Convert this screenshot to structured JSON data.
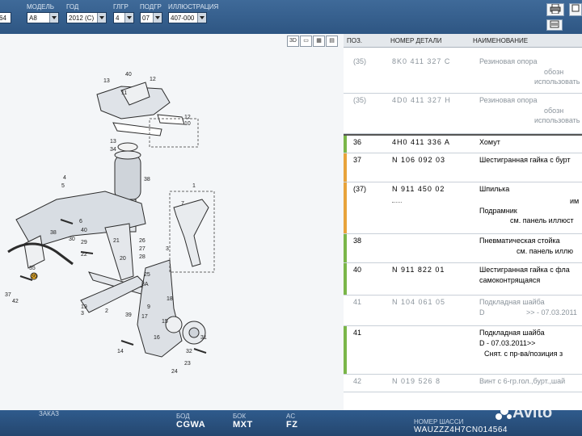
{
  "toolbar": {
    "fields": [
      {
        "label": "",
        "value": "64"
      },
      {
        "label": "МОДЕЛЬ",
        "value": "A8"
      },
      {
        "label": "ГОД",
        "value": "2012 (C)"
      },
      {
        "label": "ГЛГР",
        "value": "4"
      },
      {
        "label": "ПОДГР",
        "value": "07"
      },
      {
        "label": "ИЛЛЮСТРАЦИЯ",
        "value": "407-000"
      }
    ]
  },
  "view_buttons": [
    "3D",
    "▭",
    "▦",
    "▤"
  ],
  "table": {
    "headers": {
      "pos": "ПОЗ.",
      "part_number": "НОМЕР ДЕТАЛИ",
      "name": "НАИМЕНОВАНИЕ"
    },
    "rows": [
      {
        "pos": "(35)",
        "part_number": "8K0  411  327  C",
        "name": "Резиновая опора",
        "extra": [
          "обозн",
          "использовать"
        ],
        "greyed": true,
        "mark": ""
      },
      {
        "pos": "(35)",
        "part_number": "4D0  411  327  H",
        "name": "Резиновая опора",
        "extra": [
          "обозн",
          "использовать"
        ],
        "greyed": true,
        "mark": ""
      },
      {
        "pos": "36",
        "part_number": "4H0  411  336  A",
        "name": "Хомут",
        "extra": [],
        "greyed": false,
        "mark": "#7ab648"
      },
      {
        "pos": "37",
        "part_number": "N     106  092  03",
        "name": "Шестигранная гайка с бурт",
        "extra": [],
        "greyed": false,
        "mark": "#e8a33b"
      },
      {
        "pos": "(37)",
        "part_number": "N     911  450  02",
        "name": "Шпилька",
        "extra": [
          "им",
          "Подрамник",
          "см. панель иллюст"
        ],
        "greyed": false,
        "mark": "#e8a33b"
      },
      {
        "pos": "38",
        "part_number": "",
        "name": "Пневматическая стойка",
        "extra": [
          "см. панель иллю"
        ],
        "greyed": false,
        "mark": "#7ab648"
      },
      {
        "pos": "40",
        "part_number": "N     911  822  01",
        "name": "Шестигранная гайка с фла",
        "extra": [
          "самоконтрящаяся"
        ],
        "greyed": false,
        "mark": "#7ab648"
      },
      {
        "pos": "41",
        "part_number": "N     104  061  05",
        "name": "Подкладная шайба",
        "extra": [
          "D",
          ">> - 07.03.2011"
        ],
        "greyed": true,
        "mark": ""
      },
      {
        "pos": "41",
        "part_number": "",
        "name": "Подкладная шайба",
        "extra": [
          "D - 07.03.2011>>",
          "Снят. с пр-ва/позиция з"
        ],
        "greyed": false,
        "mark": "#7ab648"
      },
      {
        "pos": "42",
        "part_number": "N     019  526  8",
        "name": "Винт с 6-гр.гол.,бурт.,шай",
        "extra": [],
        "greyed": true,
        "mark": ""
      }
    ]
  },
  "diagram": {
    "callouts": [
      "13",
      "40",
      "12",
      "11",
      "12",
      "10",
      "13",
      "34",
      "38",
      "35",
      "36",
      "37",
      "42",
      "4",
      "5",
      "6",
      "40",
      "30",
      "38",
      "26",
      "27",
      "28",
      "29",
      "22",
      "21",
      "20",
      "19",
      "3",
      "2",
      "1",
      "7",
      "3",
      "18",
      "23",
      "24",
      "25",
      "8A",
      "9",
      "17",
      "15",
      "16",
      "14",
      "39",
      "32",
      "31"
    ]
  },
  "bottom": {
    "order_label": "ЗАКАЗ",
    "fields": [
      {
        "key": "БОД",
        "value": "CGWA"
      },
      {
        "key": "БОК",
        "value": "MXT"
      },
      {
        "key": "AC",
        "value": "FZ"
      },
      {
        "key": "НОМЕР ШАССИ",
        "value": "WAUZZZ4H7CN014564"
      }
    ],
    "watermark": "Avito"
  }
}
